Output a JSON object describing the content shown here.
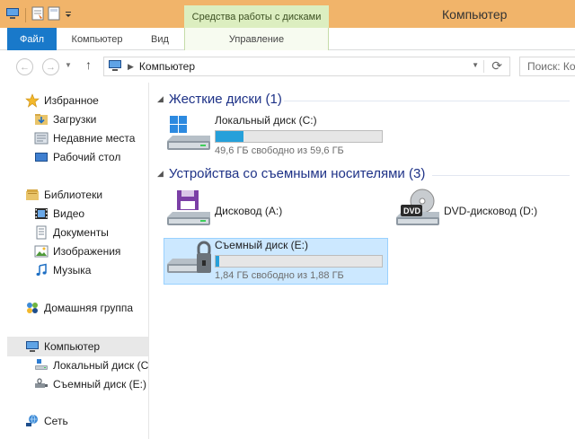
{
  "window": {
    "title": "Компьютер",
    "context_tab_group": "Средства работы с дисками"
  },
  "ribbon": {
    "tabs": [
      {
        "label": "Файл"
      },
      {
        "label": "Компьютер"
      },
      {
        "label": "Вид"
      },
      {
        "label": "Управление"
      }
    ]
  },
  "address": {
    "path": "Компьютер",
    "search_placeholder": "Поиск: Компьютер"
  },
  "sidebar": {
    "items": [
      {
        "label": "Избранное",
        "icon": "star-icon"
      },
      {
        "label": "Загрузки",
        "icon": "downloads-folder-icon"
      },
      {
        "label": "Недавние места",
        "icon": "recent-places-icon"
      },
      {
        "label": "Рабочий стол",
        "icon": "desktop-icon"
      },
      {
        "label": "Библиотеки",
        "icon": "libraries-icon"
      },
      {
        "label": "Видео",
        "icon": "video-icon"
      },
      {
        "label": "Документы",
        "icon": "documents-icon"
      },
      {
        "label": "Изображения",
        "icon": "images-icon"
      },
      {
        "label": "Музыка",
        "icon": "music-icon"
      },
      {
        "label": "Домашняя группа",
        "icon": "homegroup-icon"
      },
      {
        "label": "Компьютер",
        "icon": "computer-icon"
      },
      {
        "label": "Локальный диск (C:)",
        "icon": "hard-disk-icon"
      },
      {
        "label": "Съемный диск (E:)",
        "icon": "usb-drive-icon"
      },
      {
        "label": "Сеть",
        "icon": "network-icon"
      }
    ]
  },
  "groups": [
    {
      "title": "Жесткие диски (1)"
    },
    {
      "title": "Устройства со съемными носителями (3)"
    }
  ],
  "drives": {
    "c": {
      "name": "Локальный диск (C:)",
      "free_text": "49,6 ГБ свободно из 59,6 ГБ",
      "used_fraction": 0.168
    },
    "a": {
      "name": "Дисковод (A:)"
    },
    "d": {
      "name": "DVD-дисковод (D:)",
      "badge": "DVD"
    },
    "e": {
      "name": "Съемный диск (E:)",
      "free_text": "1,84 ГБ свободно из 1,88 ГБ",
      "used_fraction": 0.021
    }
  },
  "colors": {
    "titlebar": "#f1b46a",
    "file_tab": "#1979ca",
    "context_tab": "#dceec0",
    "progress": "#26a0da",
    "group_heading": "#1e3287",
    "selection": "#cce8ff"
  }
}
